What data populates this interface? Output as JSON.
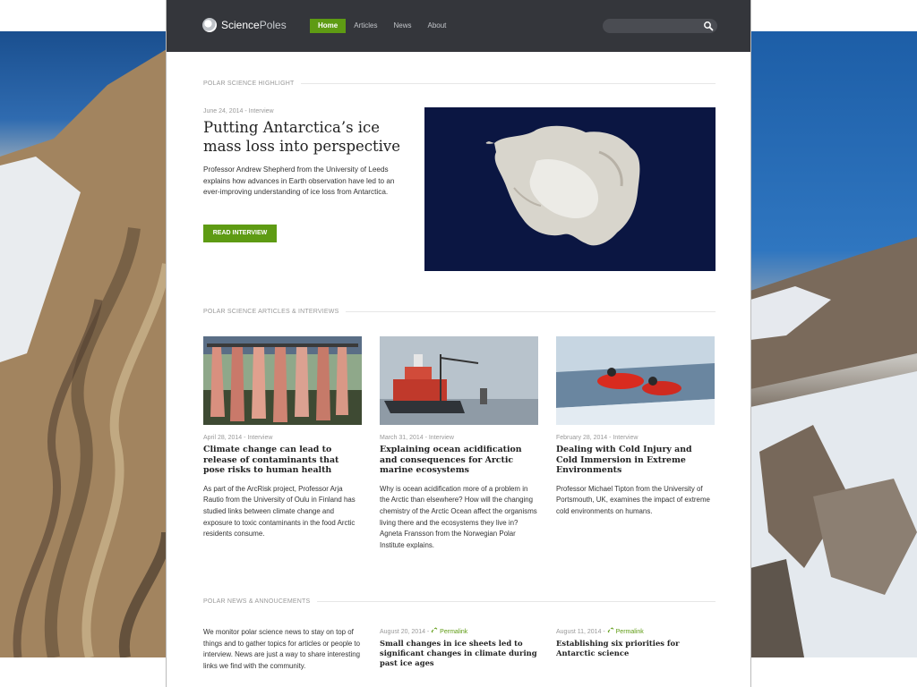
{
  "site": {
    "name_part1": "Science",
    "name_part2": "Poles",
    "nav": [
      "Home",
      "Articles",
      "News",
      "About"
    ],
    "search_placeholder": ""
  },
  "highlight": {
    "section_title": "POLAR SCIENCE HIGHLIGHT",
    "meta": "June 24, 2014 - Interview",
    "title": "Putting Antarctica’s ice mass loss into perspective",
    "text": "Professor Andrew Shepherd from the University of Leeds explains how advances in Earth observation have led to an ever-improving understanding of ice loss from Antarctica.",
    "button": "READ INTERVIEW"
  },
  "articles": {
    "section_title": "POLAR SCIENCE ARTICLES & INTERVIEWS",
    "items": [
      {
        "meta": "April 28, 2014 - Interview",
        "title": "Climate change can lead to release of contaminants that pose risks to human health",
        "text": "As part of the ArcRisk project, Professor Arja Rautio from the University of Oulu in Finland has studied links between climate change and exposure to toxic contaminants in the food Arctic residents consume."
      },
      {
        "meta": "March 31, 2014 - Interview",
        "title": "Explaining ocean acidification and consequences for Arctic marine ecosystems",
        "text": "Why is ocean acidification more of a problem in the Arctic than elsewhere? How will the changing chemistry of the Arctic Ocean affect the organisms living there and the ecosystems they live in? Agneta Fransson from the Norwegian Polar Institute explains."
      },
      {
        "meta": "February 28, 2014 - Interview",
        "title": "Dealing with Cold Injury and Cold Immersion in Extreme Environments",
        "text": "Professor Michael Tipton from the University of Portsmouth, UK, examines the impact of extreme cold environments on humans."
      }
    ]
  },
  "news": {
    "section_title": "POLAR NEWS & ANNOUCEMENTS",
    "intro": "We monitor polar science news to stay on top of things and to gather topics for articles or people to interview. News are just a way to share interesting links we find with the community.",
    "permalink_label": "Permalink",
    "items": [
      {
        "date": "August 20, 2014 - ",
        "title": "Small changes in ice sheets led to significant changes in climate during past ice ages"
      },
      {
        "date": "August 11, 2014 - ",
        "title": "Establishing six priorities for Antarctic science"
      }
    ]
  },
  "colors": {
    "accent": "#5e9b13",
    "topbar": "#34363b"
  }
}
